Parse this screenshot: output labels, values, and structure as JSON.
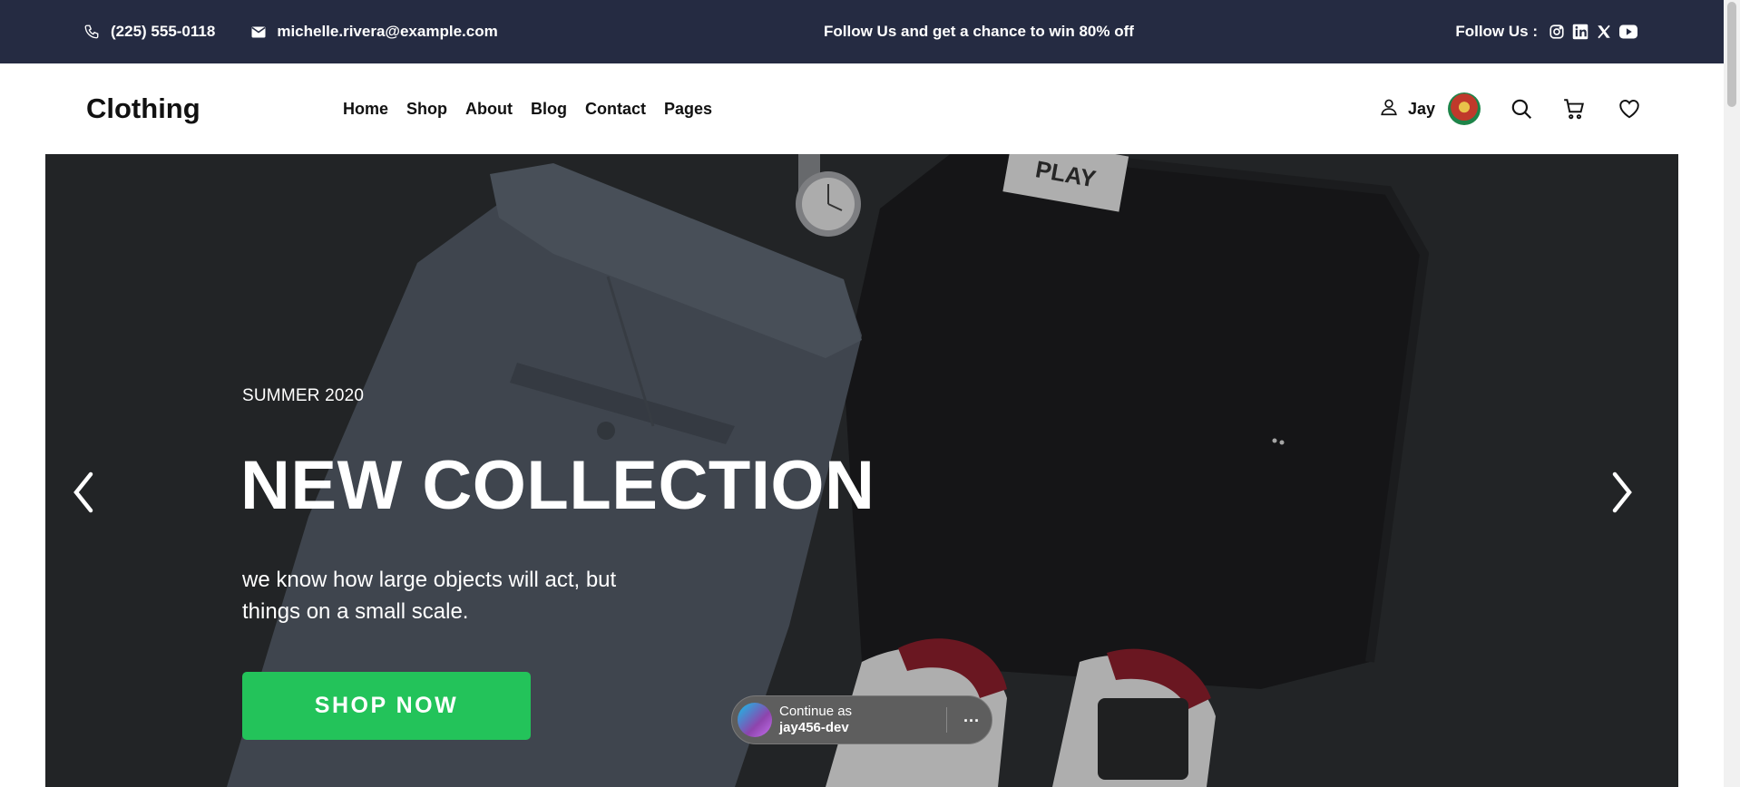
{
  "topbar": {
    "phone": "(225) 555-0118",
    "email": "michelle.rivera@example.com",
    "promo": "Follow Us and get a chance to win 80% off",
    "follow_label": "Follow Us :",
    "social_icons": [
      "instagram-icon",
      "linkedin-icon",
      "x-icon",
      "youtube-icon"
    ],
    "background": "#252b42"
  },
  "nav": {
    "brand": "Clothing",
    "menu": [
      "Home",
      "Shop",
      "About",
      "Blog",
      "Contact",
      "Pages"
    ],
    "user_name": "Jay",
    "icons": [
      "user-icon",
      "search-icon",
      "cart-icon",
      "heart-icon"
    ]
  },
  "hero": {
    "eyebrow": "SUMMER 2020",
    "title": "NEW COLLECTION",
    "description": "we know how large objects will act, but things on a small scale.",
    "cta_label": "SHOP NOW",
    "cta_color": "#23c35a",
    "arrows": [
      "chevron-left-icon",
      "chevron-right-icon"
    ]
  },
  "continue_prompt": {
    "line1": "Continue as",
    "account": "jay456-dev",
    "more_label": "···"
  }
}
